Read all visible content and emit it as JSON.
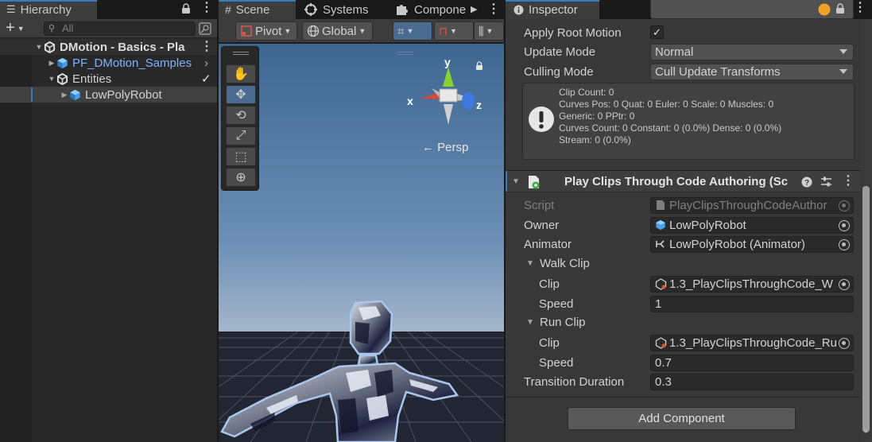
{
  "hierarchy": {
    "tab_title": "Hierarchy",
    "search_placeholder": "All",
    "items": [
      {
        "label": "DMotion - Basics - Pla",
        "kind": "scene"
      },
      {
        "label": "PF_DMotion_Samples",
        "kind": "prefab"
      },
      {
        "label": "Entities",
        "kind": "subscene"
      },
      {
        "label": "LowPolyRobot",
        "kind": "gameobject"
      }
    ]
  },
  "scene": {
    "tabs": [
      "Scene",
      "Systems",
      "Compone"
    ],
    "pivot_label": "Pivot",
    "global_label": "Global",
    "persp_label": "← Persp",
    "gizmo_axes": {
      "x": "x",
      "y": "y",
      "z": "z"
    },
    "tools": [
      "hand-tool",
      "move-tool",
      "rotate-tool",
      "scale-tool",
      "rect-tool",
      "transform-tool"
    ]
  },
  "inspector": {
    "tab_title": "Inspector",
    "animator": {
      "apply_root_motion_label": "Apply Root Motion",
      "apply_root_motion_checked": true,
      "update_mode_label": "Update Mode",
      "update_mode_value": "Normal",
      "culling_mode_label": "Culling Mode",
      "culling_mode_value": "Cull Update Transforms",
      "info_text": "Clip Count: 0\nCurves Pos: 0 Quat: 0 Euler: 0 Scale: 0 Muscles: 0\nGeneric: 0 PPtr: 0\nCurves Count: 0 Constant: 0 (0.0%) Dense: 0 (0.0%)\nStream: 0 (0.0%)"
    },
    "component": {
      "title": "Play Clips Through Code Authoring (Sc",
      "script_label": "Script",
      "script_value": "PlayClipsThroughCodeAuthor",
      "owner_label": "Owner",
      "owner_value": "LowPolyRobot",
      "animator_label": "Animator",
      "animator_value": "LowPolyRobot (Animator)",
      "walk_clip_label": "Walk Clip",
      "walk_clip_field_label": "Clip",
      "walk_clip_value": "1.3_PlayClipsThroughCode_W",
      "walk_speed_label": "Speed",
      "walk_speed_value": "1",
      "run_clip_label": "Run Clip",
      "run_clip_field_label": "Clip",
      "run_clip_value": "1.3_PlayClipsThroughCode_Ru",
      "run_speed_label": "Speed",
      "run_speed_value": "0.7",
      "transition_label": "Transition Duration",
      "transition_value": "0.3"
    },
    "add_component_label": "Add Component"
  },
  "colors": {
    "accent": "#3a79bb",
    "panel_bg": "#383838",
    "field_bg": "#2a2a2a",
    "prefab_text": "#7cb2ff",
    "selected_row": "#2c5d87"
  }
}
